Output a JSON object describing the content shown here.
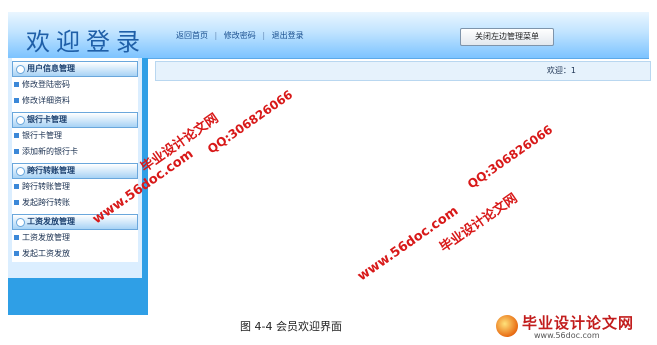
{
  "header": {
    "title": "欢迎登录",
    "nav": [
      "返回首页",
      "修改密码",
      "退出登录"
    ],
    "nav_sep": "|",
    "close_menu_button": "关闭左边管理菜单"
  },
  "sidebar": {
    "groups": [
      {
        "title": "用户信息管理",
        "items": [
          "修改登陆密码",
          "修改详细资料"
        ]
      },
      {
        "title": "银行卡管理",
        "items": [
          "银行卡管理",
          "添加新的银行卡"
        ]
      },
      {
        "title": "跨行转账管理",
        "items": [
          "跨行转账管理",
          "发起跨行转账"
        ]
      },
      {
        "title": "工资发放管理",
        "items": [
          "工资发放管理",
          "发起工资发放"
        ]
      }
    ]
  },
  "main": {
    "welcome": "欢迎：1"
  },
  "caption": "图 4-4   会员欢迎界面",
  "watermarks": {
    "brand": "毕业设计论文网",
    "site": "www.56doc.com",
    "qq": "QQ:306826066"
  },
  "footer_logo": {
    "brand": "毕业设计论文网",
    "site": "www.56doc.com"
  },
  "colors": {
    "header_gradient_top": "#eaf6ff",
    "header_gradient_bottom": "#7cc3ff",
    "sidebar_blue": "#2f9fe6",
    "watermark_red": "#d81919"
  }
}
